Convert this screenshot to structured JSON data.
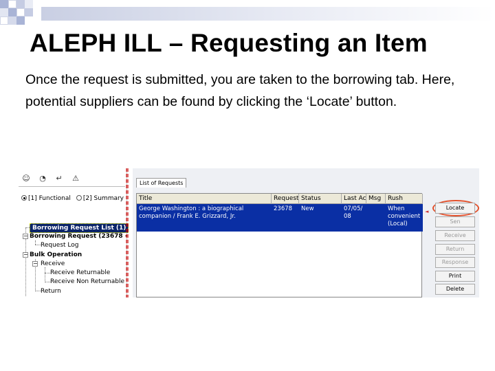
{
  "slide": {
    "title": "ALEPH ILL – Requesting an Item",
    "body": "Once the request is submitted, you are taken to the borrowing tab.  Here, potential suppliers can be found by clicking the ‘Locate’ button."
  },
  "app": {
    "radio_options": [
      "[1] Functional",
      "[2] Summary"
    ],
    "tree": {
      "borrowing_request_list": "Borrowing Request List (1)",
      "borrowing_request": "Borrowing Request (23678 -",
      "request_log": "Request Log",
      "bulk_operation": "Bulk Operation",
      "receive": "Receive",
      "receive_returnable": "Receive Returnable",
      "receive_non_returnable": "Receive Non Returnable",
      "return": "Return"
    },
    "tab_label": "List of Requests",
    "columns": [
      "Title",
      "Request",
      "Status",
      "Last Ac",
      "Msg",
      "Rush"
    ],
    "row": {
      "title": "George Washington : a biographical companion / Frank E. Grizzard, Jr.",
      "request": "23678",
      "status": "New",
      "last_action": "07/05/ 08",
      "msg": "",
      "rush": "When convenient (Local)"
    },
    "buttons": [
      "Locate",
      "Sen",
      "Receive",
      "Return",
      "Response",
      "Print",
      "Delete"
    ]
  }
}
